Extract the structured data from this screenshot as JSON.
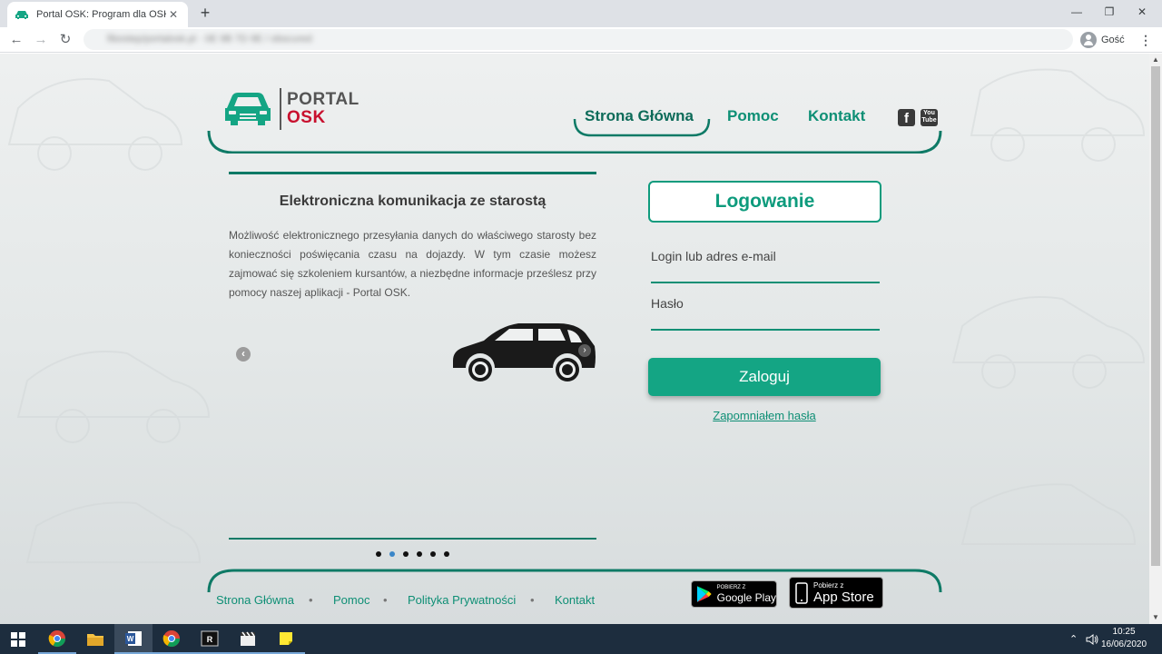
{
  "browser": {
    "tab_title": "Portal OSK: Program dla OSK i Kursantów",
    "tab_close": "✕",
    "new_tab": "+",
    "url": "fibostep/portalosk.pl · 0E 9B 7D 9E / obscured",
    "profile_name": "Gość",
    "back_glyph": "←",
    "forward_glyph": "→",
    "reload_glyph": "↻",
    "menu_glyph": "⋮",
    "min_glyph": "—",
    "max_glyph": "❐",
    "close_glyph": "✕"
  },
  "site": {
    "logo": {
      "line1": "PORTAL",
      "line2": "OSK"
    },
    "nav": [
      {
        "label": "Strona Główna",
        "active": true
      },
      {
        "label": "Pomoc",
        "active": false
      },
      {
        "label": "Kontakt",
        "active": false
      }
    ],
    "social": {
      "facebook": "f",
      "youtube": "You Tube"
    },
    "accent": "#0e9b7d",
    "logo_red": "#c8102e"
  },
  "slider": {
    "title": "Elektroniczna komunikacja ze starostą",
    "text": "Możliwość elektronicznego przesyłania danych do właściwego starosty bez konieczności poświęcania czasu na dojazdy. W tym czasie możesz zajmować się szkoleniem kursantów, a niezbędne informacje prześlesz przy pomocy naszej aplikacji - Portal OSK.",
    "prev_glyph": "‹",
    "next_glyph": "›",
    "dots": 6,
    "active_dot": 1
  },
  "login": {
    "title": "Logowanie",
    "login_label": "Login lub adres e-mail",
    "password_label": "Hasło",
    "submit": "Zaloguj",
    "forgot": "Zapomniałem hasła"
  },
  "footer": {
    "links": [
      "Strona Główna",
      "Pomoc",
      "Polityka Prywatności",
      "Kontakt"
    ],
    "bullet": "•",
    "google_play": {
      "small": "POBIERZ Z",
      "big": "Google Play"
    },
    "app_store": {
      "small": "Pobierz z",
      "big": "App Store"
    }
  },
  "taskbar": {
    "time": "10:25",
    "date": "16/06/2020",
    "tray_up": "⌃",
    "volume": "🔊"
  }
}
